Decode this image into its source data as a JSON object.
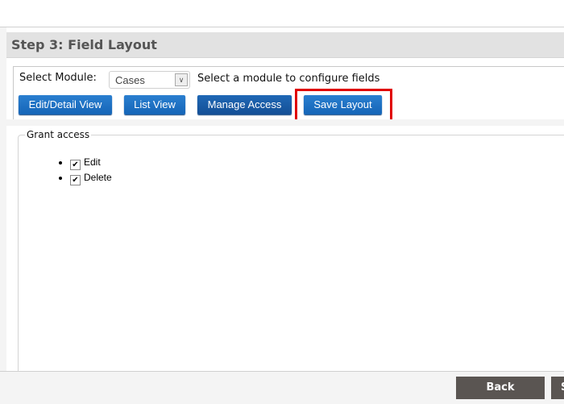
{
  "header": {
    "title": "Step 3: Field Layout"
  },
  "module": {
    "label": "Select Module:",
    "selected": "Cases",
    "hint": "Select a module to configure fields"
  },
  "toolbar": {
    "edit_detail": "Edit/Detail View",
    "list_view": "List View",
    "manage_access": "Manage Access",
    "save_layout": "Save Layout"
  },
  "highlight_color": "#e00000",
  "access": {
    "legend": "Grant access",
    "items": [
      {
        "label": "Edit",
        "checked": true
      },
      {
        "label": "Delete",
        "checked": true
      }
    ]
  },
  "footer": {
    "back": "Back",
    "next": "S"
  }
}
